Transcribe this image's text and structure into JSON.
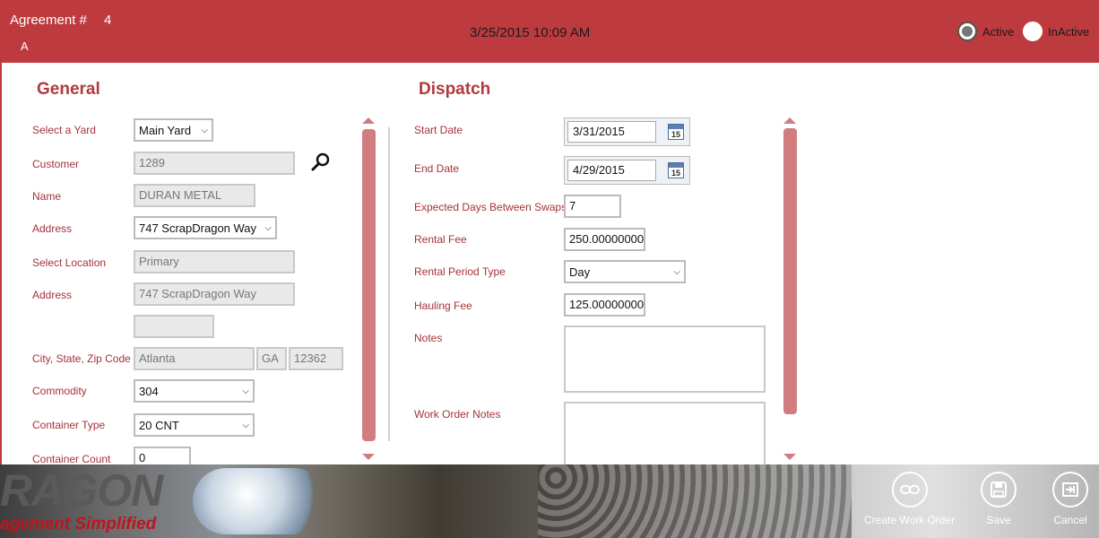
{
  "header": {
    "agreement_label": "Agreement #",
    "agreement_number": "4",
    "agreement_status_code": "A",
    "datetime": "3/25/2015 10:09 AM",
    "status_options": [
      {
        "label": "Active",
        "checked": true
      },
      {
        "label": "InActive",
        "checked": false
      }
    ]
  },
  "general": {
    "title": "General",
    "yard": {
      "label": "Select a Yard",
      "value": "Main Yard"
    },
    "customer": {
      "label": "Customer",
      "value": "1289"
    },
    "name": {
      "label": "Name",
      "value": "DURAN METAL"
    },
    "address_select": {
      "label": "Address",
      "value": "747 ScrapDragon Way"
    },
    "location": {
      "label": "Select Location",
      "value": "Primary"
    },
    "address": {
      "label": "Address",
      "line1": "747 ScrapDragon Way",
      "line2": ""
    },
    "city_state_zip": {
      "label": "City, State, Zip Code",
      "city": "Atlanta",
      "state": "GA",
      "zip": "12362"
    },
    "commodity": {
      "label": "Commodity",
      "value": "304"
    },
    "container_type": {
      "label": "Container Type",
      "value": "20 CNT"
    },
    "container_count": {
      "label": "Container Count",
      "value": "0"
    }
  },
  "dispatch": {
    "title": "Dispatch",
    "start_date": {
      "label": "Start Date",
      "value": "3/31/2015",
      "cal_day": "15"
    },
    "end_date": {
      "label": "End Date",
      "value": "4/29/2015",
      "cal_day": "15"
    },
    "expected_days": {
      "label": "Expected Days Between Swaps",
      "value": "7"
    },
    "rental_fee": {
      "label": "Rental Fee",
      "value": "250.00000000"
    },
    "rental_period_type": {
      "label": "Rental Period Type",
      "value": "Day"
    },
    "hauling_fee": {
      "label": "Hauling Fee",
      "value": "125.00000000"
    },
    "notes": {
      "label": "Notes",
      "value": ""
    },
    "work_order_notes": {
      "label": "Work Order Notes",
      "value": ""
    }
  },
  "footer": {
    "brand_main": "RAGON",
    "brand_tagline": "agement Simplified",
    "buttons": [
      {
        "label": "Create Work Order",
        "icon": "link-icon"
      },
      {
        "label": "Save",
        "icon": "save-icon"
      },
      {
        "label": "Cancel",
        "icon": "exit-icon"
      }
    ]
  },
  "colors": {
    "brand_red": "#bd3a3f",
    "label_red": "#a5323a",
    "scroll_red": "#d17d80"
  }
}
